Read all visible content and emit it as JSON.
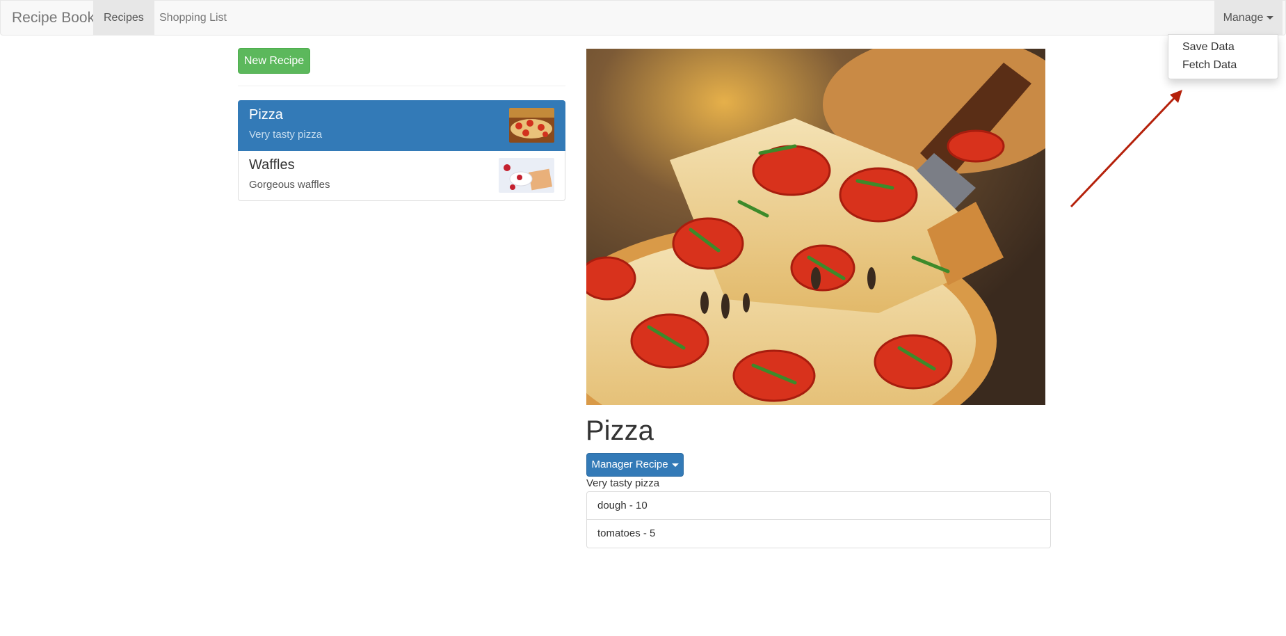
{
  "navbar": {
    "brand": "Recipe Book",
    "recipes": "Recipes",
    "shopping_list": "Shopping List",
    "manage": "Manage"
  },
  "manage_menu": {
    "save": "Save Data",
    "fetch": "Fetch Data"
  },
  "sidebar": {
    "new_recipe": "New Recipe",
    "recipes": [
      {
        "name": "Pizza",
        "description": "Very tasty pizza"
      },
      {
        "name": "Waffles",
        "description": "Gorgeous waffles"
      }
    ]
  },
  "detail": {
    "title": "Pizza",
    "manage_button": "Manager Recipe",
    "description": "Very tasty pizza",
    "ingredients": [
      "dough - 10",
      "tomatoes - 5"
    ]
  },
  "colors": {
    "primary": "#337ab7",
    "success": "#5cb85c",
    "annotation_arrow": "#b5210b"
  }
}
